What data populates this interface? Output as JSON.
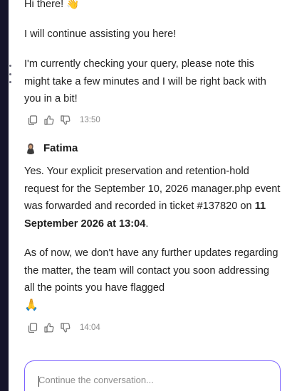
{
  "messages": [
    {
      "greeting": "Hi there! 👋",
      "paragraphs": [
        "I will continue assisting you here!",
        "I'm currently checking your query, please note this might take a few minutes and I will be right back with you in a bit!"
      ],
      "time": "13:50"
    },
    {
      "agent_name": "Fatima",
      "p1_before": "Yes. Your explicit preservation and retention-hold request for the September 10, 2026 manager.php event was forwarded and recorded in ticket #137820 on ",
      "p1_bold": "11 September 2026 at 13:04",
      "p1_after": ".",
      "p2": "As of now, we don't have any further updates regarding the matter, the team will contact you soon addressing all the points you have flagged",
      "emoji": "🙏",
      "time": "14:04"
    }
  ],
  "composer": {
    "placeholder": "Continue the conversation..."
  },
  "colors": {
    "rail": "#16142a",
    "accent": "#7b61ff"
  },
  "icons": [
    "copy-icon",
    "thumbs-up-icon",
    "thumbs-down-icon",
    "agent-avatar"
  ]
}
